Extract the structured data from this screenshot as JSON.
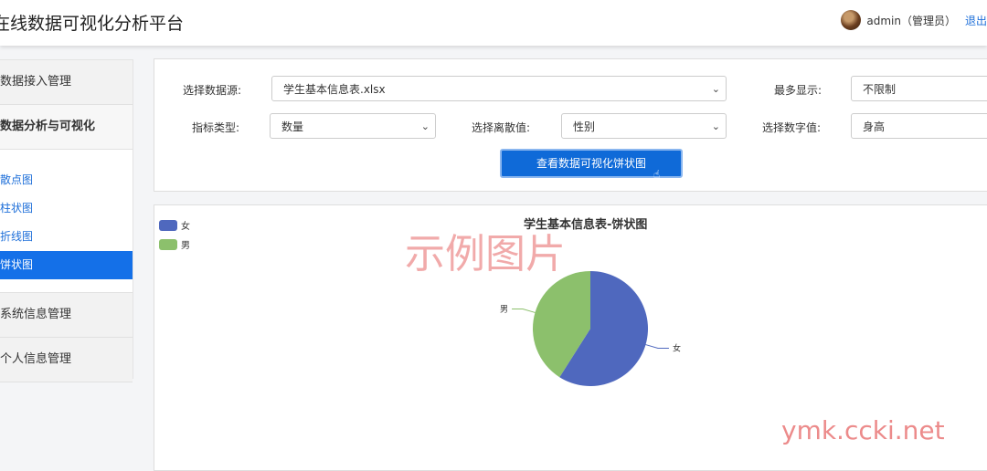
{
  "header": {
    "app_title": "在线数据可视化分析平台",
    "user_name": "admin（管理员）",
    "logout_label": "退出"
  },
  "sidebar": {
    "data_access": "数据接入管理",
    "analysis_group": "数据分析与可视化",
    "items": [
      "散点图",
      "柱状图",
      "折线图",
      "饼状图"
    ],
    "system_info": "系统信息管理",
    "personal_info": "个人信息管理"
  },
  "form": {
    "datasource_label": "选择数据源:",
    "datasource_value": "学生基本信息表.xlsx",
    "max_display_label": "最多显示:",
    "max_display_value": "不限制",
    "metric_type_label": "指标类型:",
    "metric_type_value": "数量",
    "discrete_label": "选择离散值:",
    "discrete_value": "性别",
    "numeric_label": "选择数字值:",
    "numeric_value": "身高",
    "submit_label": "查看数据可视化饼状图"
  },
  "chart_data": {
    "type": "pie",
    "title": "学生基本信息表-饼状图",
    "categories": [
      "女",
      "男"
    ],
    "values": [
      59,
      41
    ],
    "colors": [
      "#4f68be",
      "#8cc06c"
    ],
    "legend_position": "top-left"
  },
  "watermarks": {
    "chart_stamp": "示例图片",
    "site": "ymk.ccki.net"
  }
}
